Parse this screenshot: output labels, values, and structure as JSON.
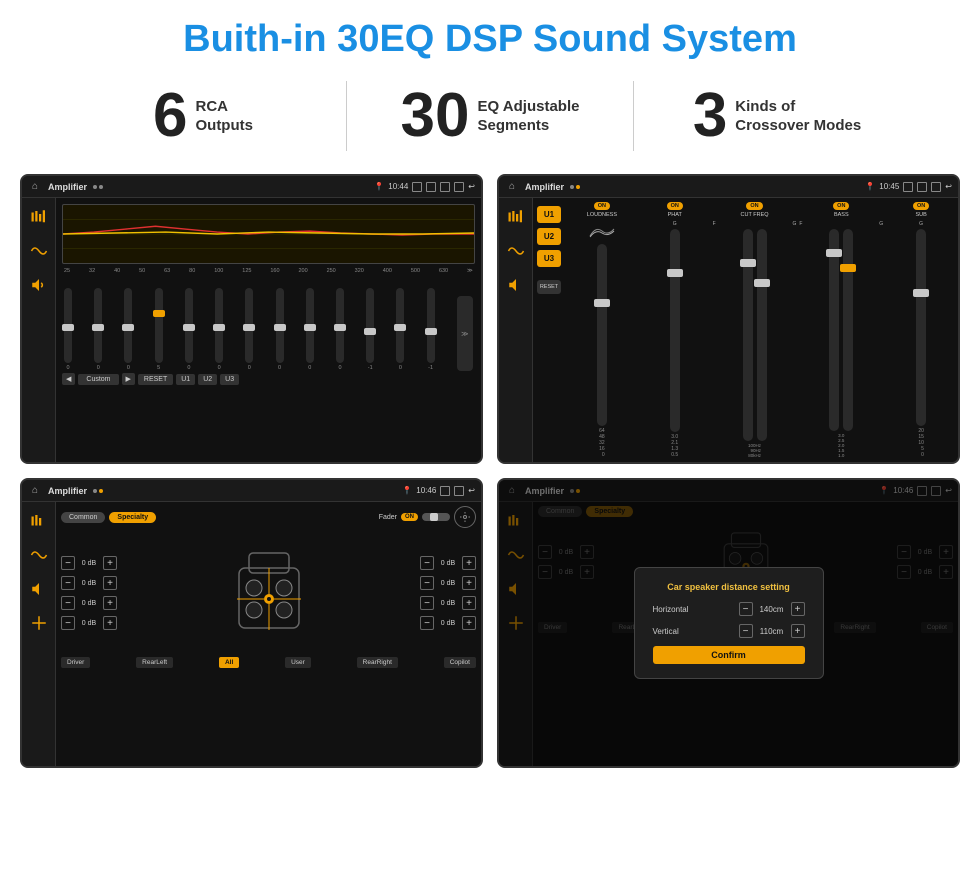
{
  "title": "Buith-in 30EQ DSP Sound System",
  "stats": [
    {
      "number": "6",
      "label": "RCA\nOutputs"
    },
    {
      "number": "30",
      "label": "EQ Adjustable\nSegments"
    },
    {
      "number": "3",
      "label": "Kinds of\nCrossover Modes"
    }
  ],
  "screen1": {
    "topbar": {
      "title": "Amplifier",
      "time": "10:44"
    },
    "freqLabels": [
      "25",
      "32",
      "40",
      "50",
      "63",
      "80",
      "100",
      "125",
      "160",
      "200",
      "250",
      "320",
      "400",
      "500",
      "630"
    ],
    "sliderValues": [
      "0",
      "0",
      "0",
      "5",
      "0",
      "0",
      "0",
      "0",
      "0",
      "0",
      "0",
      "-1",
      "0",
      "-1"
    ],
    "buttons": [
      "◀",
      "Custom",
      "▶",
      "RESET",
      "U1",
      "U2",
      "U3"
    ]
  },
  "screen2": {
    "topbar": {
      "title": "Amplifier",
      "time": "10:45"
    },
    "uButtons": [
      "U1",
      "U2",
      "U3"
    ],
    "modules": [
      {
        "toggle": "ON",
        "label": "LOUDNESS"
      },
      {
        "toggle": "ON",
        "label": "PHAT"
      },
      {
        "toggle": "ON",
        "label": "CUT FREQ"
      },
      {
        "toggle": "ON",
        "label": "BASS"
      },
      {
        "toggle": "ON",
        "label": "SUB"
      }
    ],
    "resetBtn": "RESET"
  },
  "screen3": {
    "topbar": {
      "title": "Amplifier",
      "time": "10:46"
    },
    "tabButtons": [
      "Common",
      "Specialty"
    ],
    "faderLabel": "Fader",
    "faderToggle": "ON",
    "dbRows": [
      {
        "value": "0 dB"
      },
      {
        "value": "0 dB"
      },
      {
        "value": "0 dB"
      },
      {
        "value": "0 dB"
      }
    ],
    "bottomButtons": [
      "Driver",
      "RearLeft",
      "All",
      "User",
      "RearRight",
      "Copilot"
    ]
  },
  "screen4": {
    "topbar": {
      "title": "Amplifier",
      "time": "10:46"
    },
    "tabButtons": [
      "Common",
      "Specialty"
    ],
    "dialog": {
      "title": "Car speaker distance setting",
      "rows": [
        {
          "label": "Horizontal",
          "value": "140cm"
        },
        {
          "label": "Vertical",
          "value": "110cm"
        }
      ],
      "confirmBtn": "Confirm"
    },
    "dbRows": [
      {
        "value": "0 dB"
      },
      {
        "value": "0 dB"
      }
    ],
    "bottomButtons": [
      "Driver",
      "RearLeft..",
      "All",
      "User",
      "RearRight",
      "Copilot"
    ]
  }
}
